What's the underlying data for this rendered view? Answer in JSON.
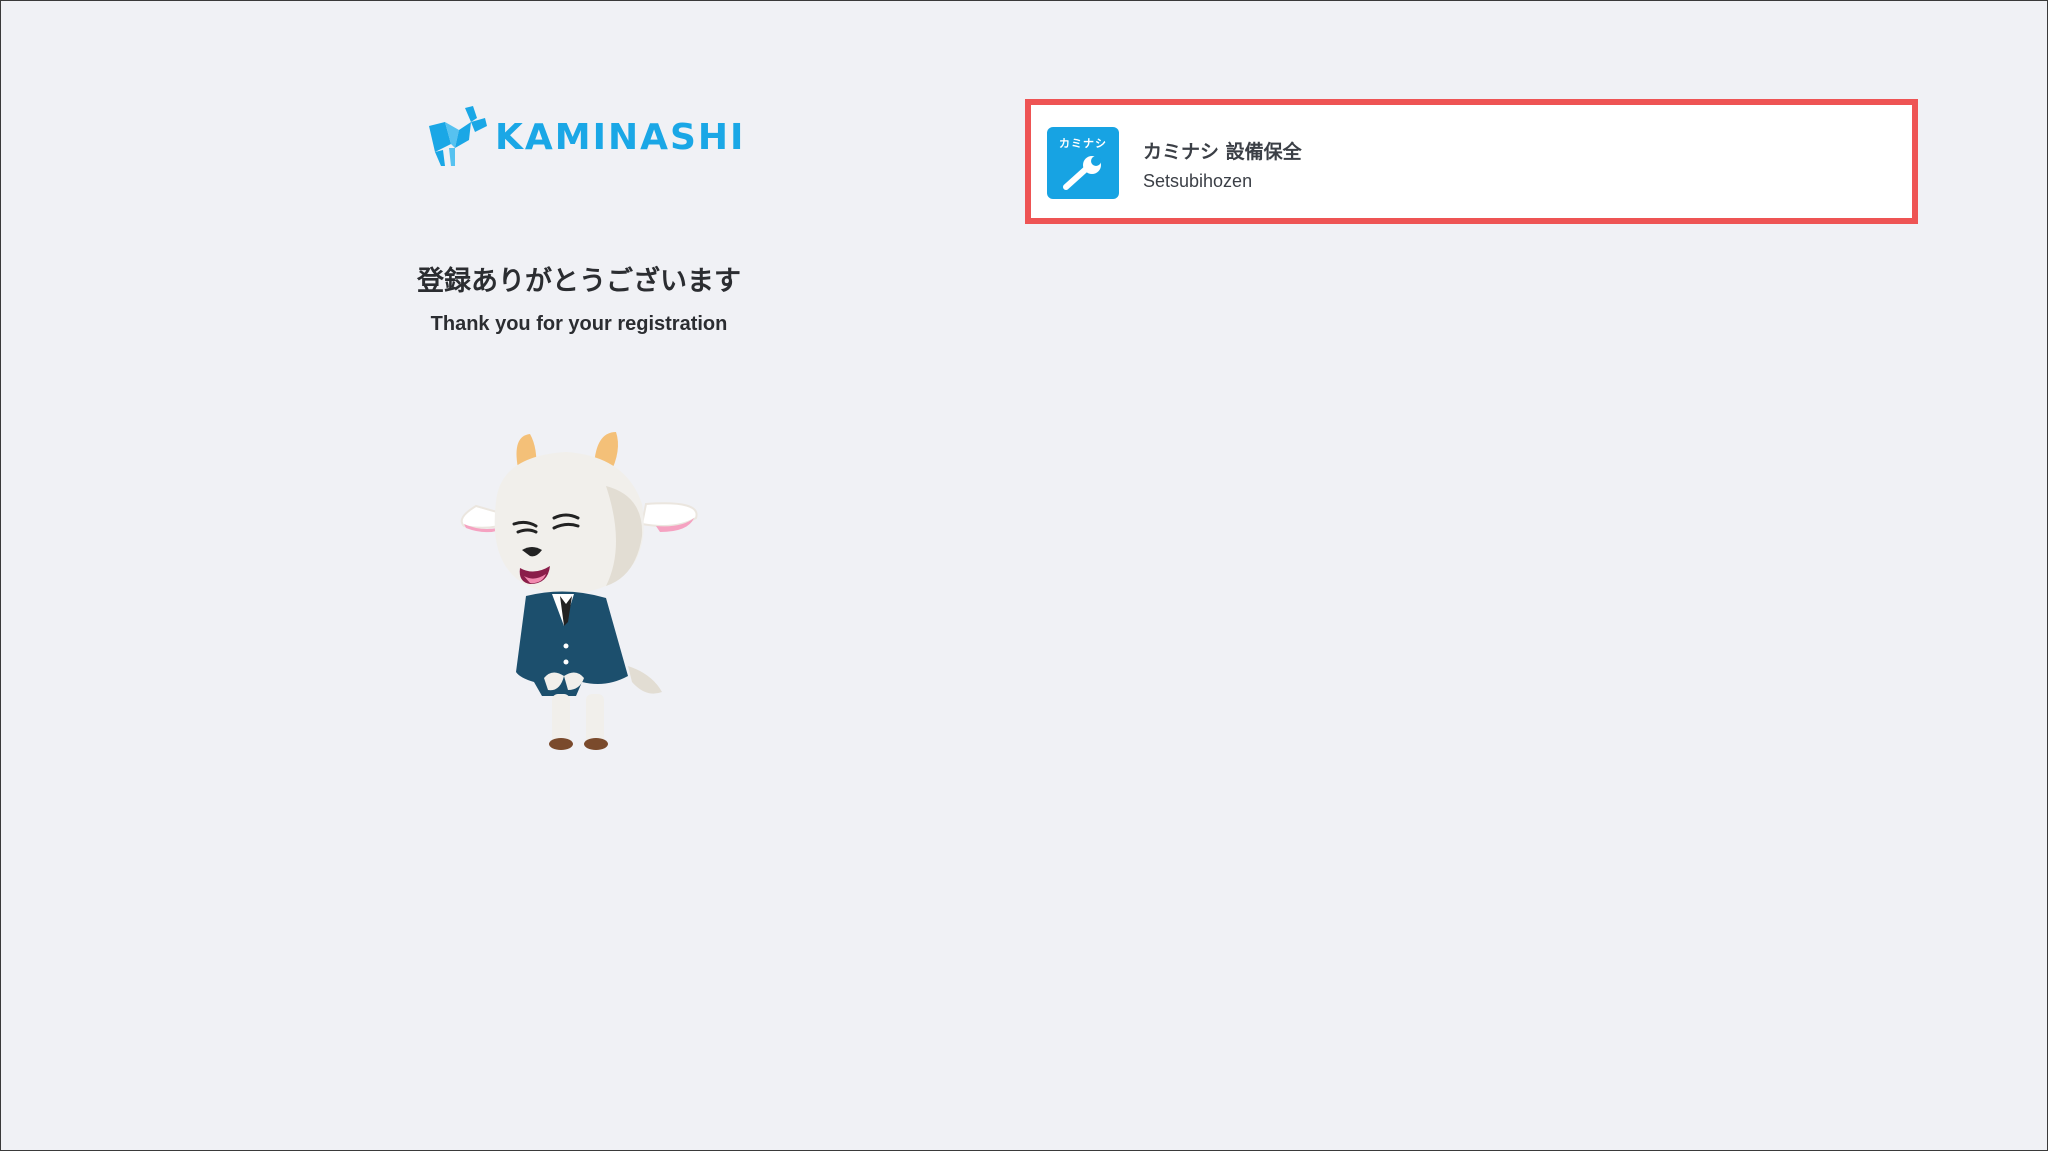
{
  "brand": {
    "logo_text": "KAMINASHI",
    "brand_color": "#1aa7e6"
  },
  "left": {
    "heading_ja": "登録ありがとうございます",
    "heading_en": "Thank you for your registration"
  },
  "app_card": {
    "icon_label": "カミナシ",
    "icon_name": "wrench-icon",
    "name": "カミナシ 設備保全",
    "subtitle": "Setsubihozen",
    "highlight_color": "#ee5454",
    "icon_color": "#17a3e3"
  }
}
